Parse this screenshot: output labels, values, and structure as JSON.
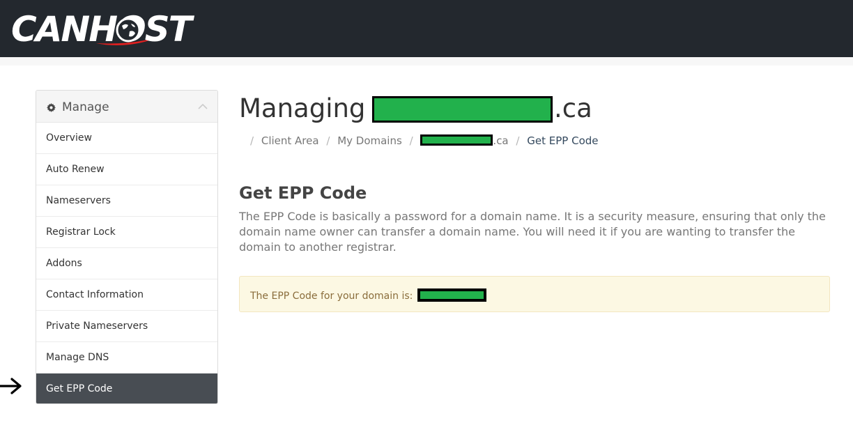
{
  "header": {
    "logo_text": "CANHOST"
  },
  "sidebar": {
    "title": "Manage",
    "items": [
      {
        "label": "Overview"
      },
      {
        "label": "Auto Renew"
      },
      {
        "label": "Nameservers"
      },
      {
        "label": "Registrar Lock"
      },
      {
        "label": "Addons"
      },
      {
        "label": "Contact Information"
      },
      {
        "label": "Private Nameservers"
      },
      {
        "label": "Manage DNS"
      },
      {
        "label": "Get EPP Code"
      }
    ],
    "active_index": 8
  },
  "main": {
    "heading_prefix": "Managing",
    "heading_suffix": ".ca",
    "breadcrumb": {
      "items": [
        "Client Area",
        "My Domains"
      ],
      "domain_suffix": ".ca",
      "current": "Get EPP Code"
    },
    "section_title": "Get EPP Code",
    "description": "The EPP Code is basically a password for a domain name. It is a security measure, ensuring that only the domain name owner can transfer a domain name. You will need it if you are wanting to transfer the domain to another registrar.",
    "alert_text": "The EPP Code for your domain is:"
  },
  "colors": {
    "topbar": "#23282e",
    "active_item": "#484d53",
    "redaction": "#22b14c",
    "alert_bg": "#fcf8e3",
    "alert_text": "#8a6d3b",
    "breadcrumb_active": "#34495e"
  }
}
